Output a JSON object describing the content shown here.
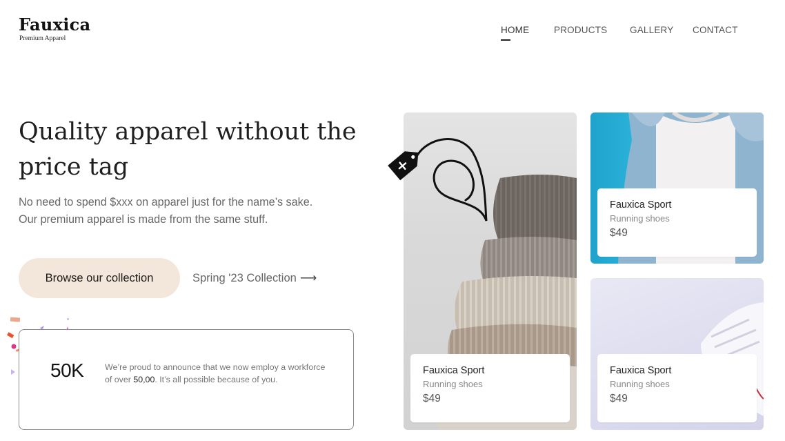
{
  "brand": {
    "name": "Fauxica",
    "tagline": "Premium Apparel"
  },
  "nav": {
    "items": [
      "HOME",
      "PRODUCTS",
      "GALLERY",
      "CONTACT"
    ],
    "active_index": 0
  },
  "hero": {
    "title": "Quality apparel without the price tag",
    "subtitle_line1": "No need to spend $xxx on apparel just for the name’s sake.",
    "subtitle_line2": "Our premium apparel is made from the same stuff.",
    "cta_label": "Browse our collection",
    "link_label": "Spring '23 Collection",
    "link_arrow": "⟶"
  },
  "stat": {
    "value": "50K",
    "text_before": "We’re proud to announce that we now employ a workforce of over ",
    "text_highlight": "50,00",
    "text_after": ". It’s all possible because of you."
  },
  "products": [
    {
      "title": "Fauxica Sport",
      "subtitle": "Running shoes",
      "price": "$49"
    },
    {
      "title": "Fauxica Sport",
      "subtitle": "Running shoes",
      "price": "$49"
    },
    {
      "title": "Fauxica Sport",
      "subtitle": "Running shoes",
      "price": "$49"
    }
  ],
  "colors": {
    "cta_bg": "#f3e6da",
    "denim_bg": "#2db5dc",
    "text_dark": "#1a1a1a",
    "text_muted": "#666666"
  }
}
